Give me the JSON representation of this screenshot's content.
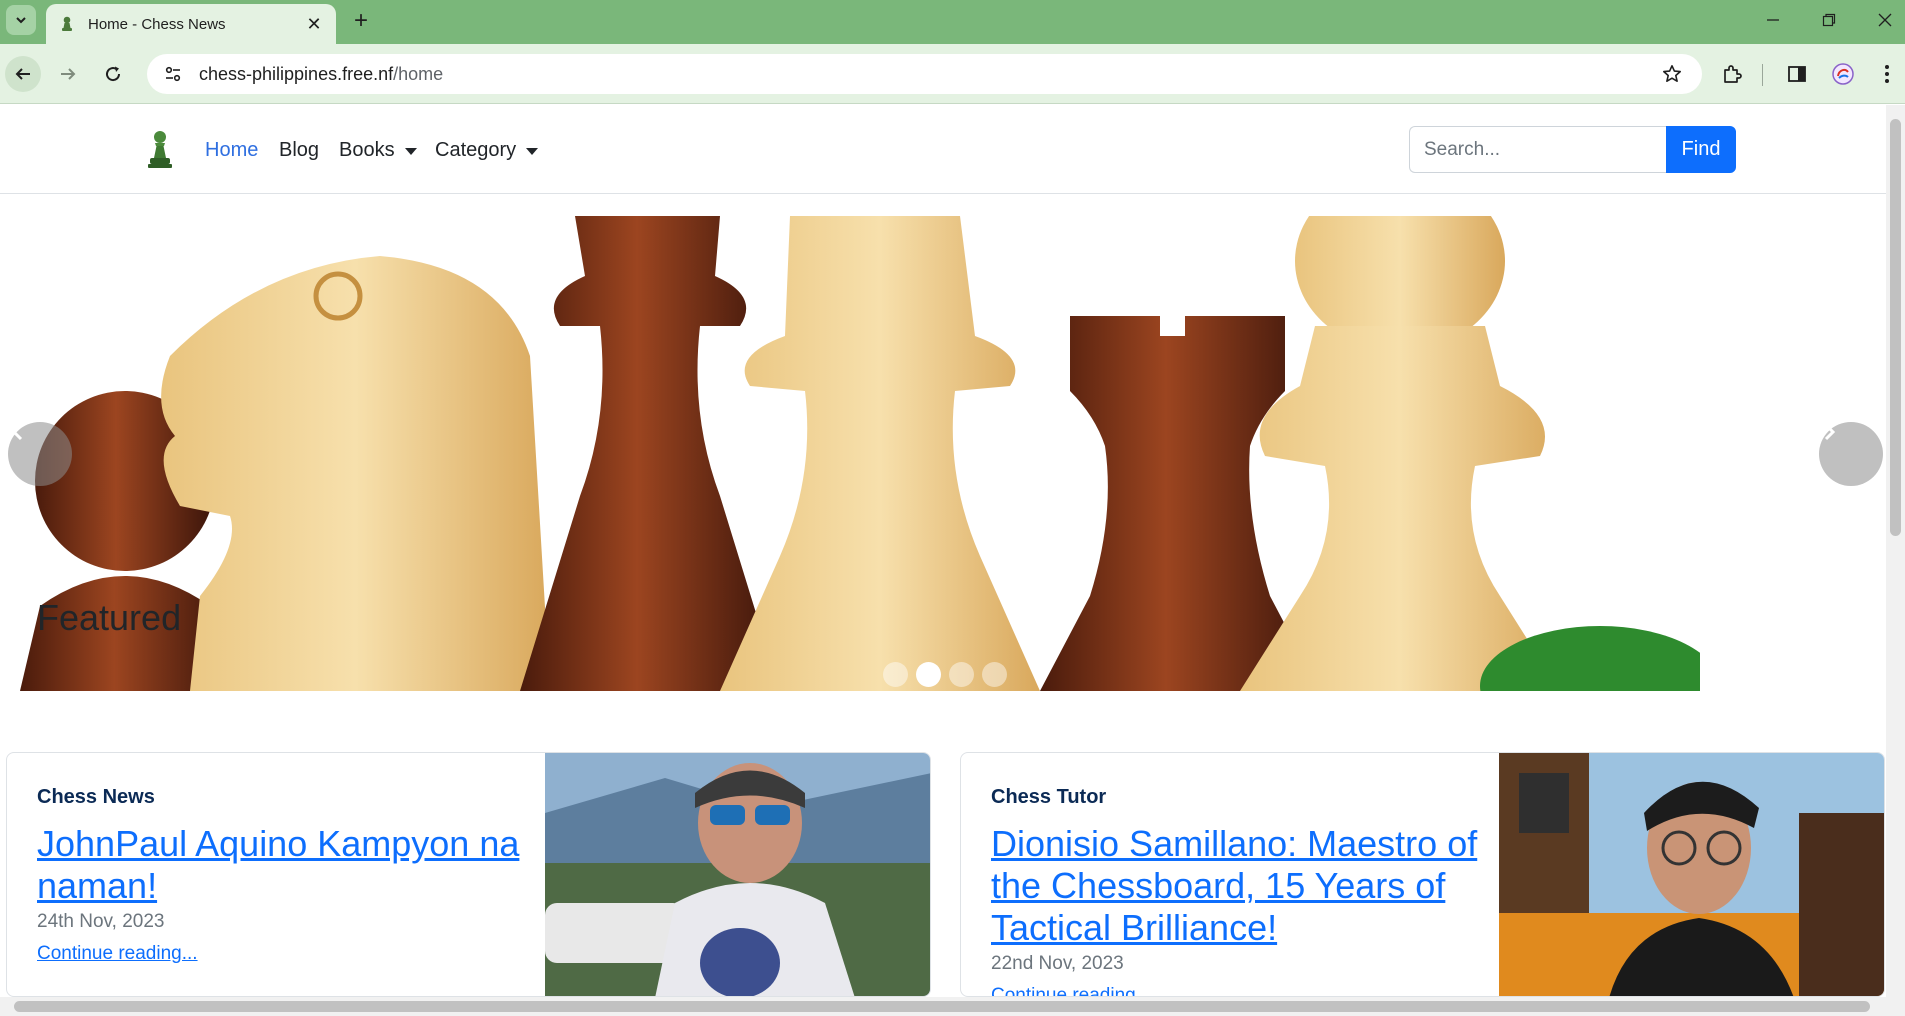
{
  "browser": {
    "tab_title": "Home - Chess News",
    "url_host": "chess-philippines.free.nf",
    "url_path": "/home"
  },
  "navbar": {
    "links": [
      {
        "label": "Home",
        "active": true
      },
      {
        "label": "Blog"
      },
      {
        "label": "Books",
        "dropdown": true
      },
      {
        "label": "Category",
        "dropdown": true
      }
    ],
    "search_placeholder": "Search...",
    "find_label": "Find"
  },
  "carousel": {
    "slide_count": 4,
    "active_slide_index": 1
  },
  "featured": {
    "heading": "Featured",
    "cards": [
      {
        "category": "Chess News",
        "title": "JohnPaul Aquino Kampyon na naman!",
        "date": "24th Nov, 2023",
        "link_label": "Continue reading..."
      },
      {
        "category": "Chess Tutor",
        "title": "Dionisio Samillano: Maestro of the Chessboard, 15 Years of Tactical Brilliance!",
        "date": "22nd Nov, 2023",
        "link_label": "Continue reading..."
      }
    ]
  },
  "colors": {
    "accent": "#0d6efd",
    "chrome_frame": "#7ab77a",
    "chrome_toolbar": "#e4f2e2"
  }
}
